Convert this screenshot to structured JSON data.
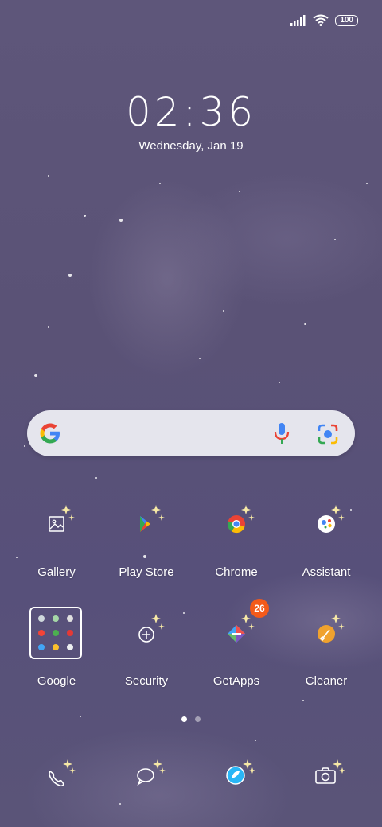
{
  "status_bar": {
    "battery": "100"
  },
  "clock": {
    "time": "02:36",
    "date": "Wednesday, Jan 19"
  },
  "search": {
    "icons": [
      "google-g-icon",
      "mic-icon",
      "lens-icon"
    ]
  },
  "apps_row1": [
    {
      "label": "Gallery",
      "icon": "gallery-icon"
    },
    {
      "label": "Play Store",
      "icon": "play-store-icon"
    },
    {
      "label": "Chrome",
      "icon": "chrome-icon"
    },
    {
      "label": "Assistant",
      "icon": "assistant-icon"
    }
  ],
  "apps_row2": [
    {
      "label": "Google",
      "icon": "folder-icon"
    },
    {
      "label": "Security",
      "icon": "security-icon"
    },
    {
      "label": "GetApps",
      "icon": "getapps-icon",
      "badge": "26"
    },
    {
      "label": "Cleaner",
      "icon": "cleaner-icon"
    }
  ],
  "dock": [
    "phone-icon",
    "messages-icon",
    "browser-icon",
    "camera-icon"
  ],
  "pager": {
    "pages": 2,
    "current": 1
  },
  "colors": {
    "badge": "#f35a1a",
    "wallpaper": "#5a5276"
  }
}
